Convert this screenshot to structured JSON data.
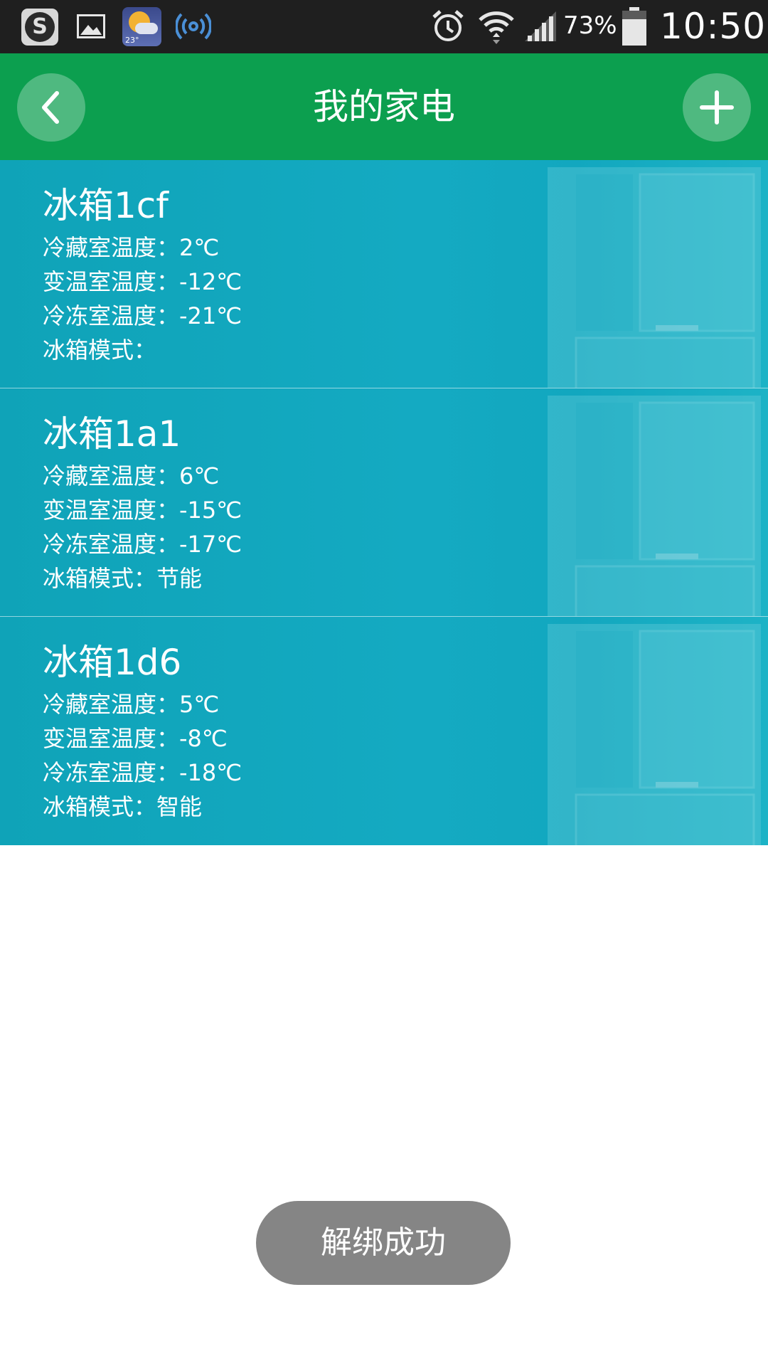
{
  "status_bar": {
    "battery_percent": "73%",
    "time": "10:50",
    "weather_temp": "23°",
    "icons": [
      "s-app-icon",
      "gallery-icon",
      "weather-icon",
      "wireless-icon",
      "alarm-icon",
      "wifi-icon",
      "cell-signal-icon",
      "battery-icon"
    ]
  },
  "header": {
    "title": "我的家电",
    "back_icon": "chevron-left-icon",
    "add_icon": "plus-icon"
  },
  "devices": [
    {
      "name": "冰箱1cf",
      "fridge_temp": "冷藏室温度：2℃",
      "variable_temp": "变温室温度：-12℃",
      "freezer_temp": "冷冻室温度：-21℃",
      "mode": "冰箱模式："
    },
    {
      "name": "冰箱1a1",
      "fridge_temp": "冷藏室温度：6℃",
      "variable_temp": "变温室温度：-15℃",
      "freezer_temp": "冷冻室温度：-17℃",
      "mode": "冰箱模式：节能"
    },
    {
      "name": "冰箱1d6",
      "fridge_temp": "冷藏室温度：5℃",
      "variable_temp": "变温室温度：-8℃",
      "freezer_temp": "冷冻室温度：-18℃",
      "mode": "冰箱模式：智能"
    }
  ],
  "toast": {
    "text": "解绑成功"
  },
  "colors": {
    "header": "#0c9f4f",
    "card": "#14aac2",
    "toast": "#858585",
    "status_bar": "#1f1f1f"
  }
}
